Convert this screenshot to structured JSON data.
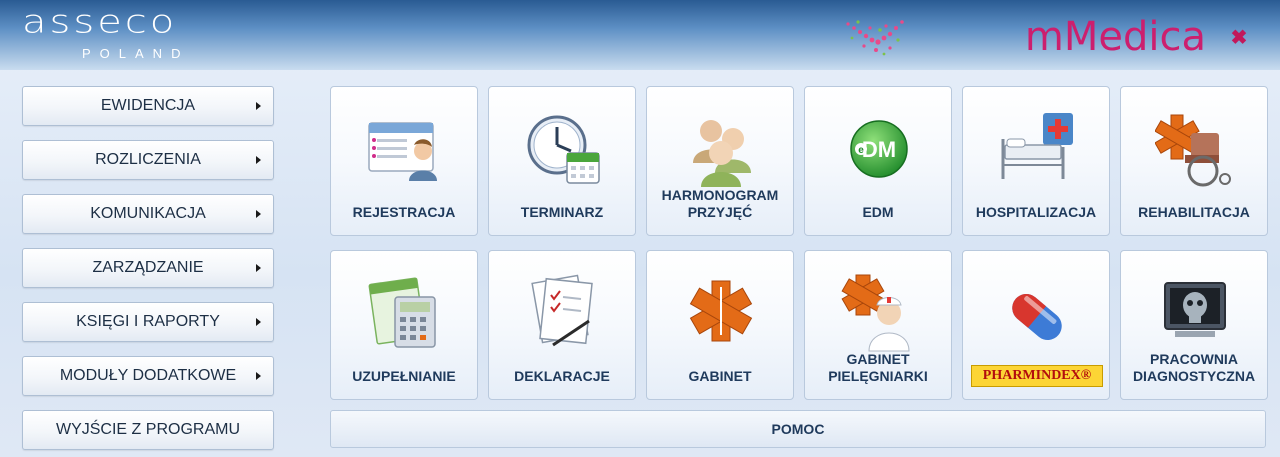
{
  "header": {
    "logo_main": "asseco",
    "logo_sub": "POLAND",
    "brand": "mMedica",
    "close_symbol": "✖"
  },
  "menu": [
    {
      "label": "EWIDENCJA",
      "has_submenu": true
    },
    {
      "label": "ROZLICZENIA",
      "has_submenu": true
    },
    {
      "label": "KOMUNIKACJA",
      "has_submenu": true
    },
    {
      "label": "ZARZĄDZANIE",
      "has_submenu": true
    },
    {
      "label": "KSIĘGI I RAPORTY",
      "has_submenu": true
    },
    {
      "label": "MODUŁY DODATKOWE",
      "has_submenu": true
    },
    {
      "label": "WYJŚCIE Z PROGRAMU",
      "has_submenu": false
    }
  ],
  "tiles": [
    {
      "label": "REJESTRACJA",
      "icon": "registration-icon"
    },
    {
      "label": "TERMINARZ",
      "icon": "clock-calendar-icon"
    },
    {
      "label": "HARMONOGRAM\nPRZYJĘĆ",
      "icon": "people-icon"
    },
    {
      "label": "EDM",
      "icon": "edm-icon"
    },
    {
      "label": "HOSPITALIZACJA",
      "icon": "hospital-bed-icon"
    },
    {
      "label": "REHABILITACJA",
      "icon": "wheelchair-icon",
      "highlighted": true
    },
    {
      "label": "UZUPEŁNIANIE",
      "icon": "calculator-icon"
    },
    {
      "label": "DEKLARACJE",
      "icon": "declaration-icon"
    },
    {
      "label": "GABINET",
      "icon": "star-of-life-icon"
    },
    {
      "label": "GABINET\nPIELĘGNIARKI",
      "icon": "nurse-icon"
    },
    {
      "label": "",
      "icon": "pill-icon",
      "badge": "PHARMINDEX®"
    },
    {
      "label": "PRACOWNIA\nDIAGNOSTYCZNA",
      "icon": "xray-icon"
    }
  ],
  "help": {
    "label": "POMOC"
  },
  "colors": {
    "highlight": "#e31a1a",
    "brand": "#cc1f6e",
    "tile_text": "#1f3a5c"
  }
}
